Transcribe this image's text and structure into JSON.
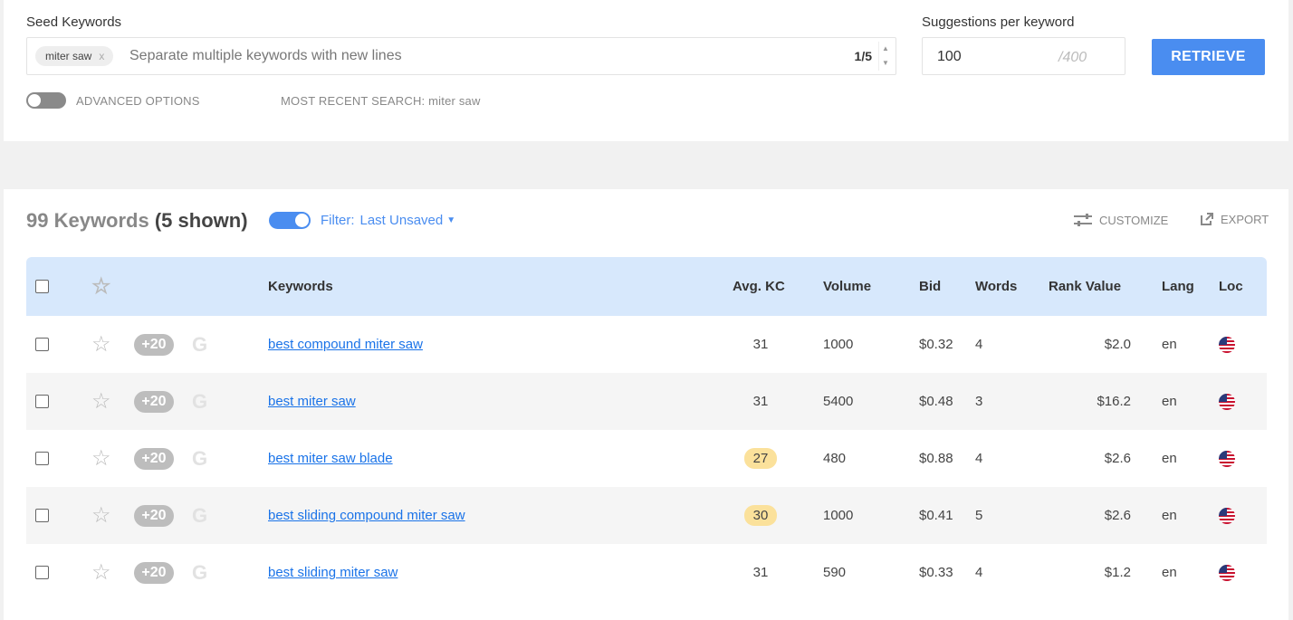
{
  "search": {
    "seed_label": "Seed Keywords",
    "seed_chip": "miter saw",
    "seed_chip_remove": "x",
    "seed_placeholder": "Separate multiple keywords with new lines",
    "seed_counter": "1/5",
    "suggestions_label": "Suggestions per keyword",
    "suggestions_value": "100",
    "suggestions_max": "/400",
    "retrieve_label": "RETRIEVE",
    "advanced_label": "ADVANCED OPTIONS",
    "advanced_enabled": false,
    "recent_label": "MOST RECENT SEARCH: miter saw"
  },
  "results": {
    "count_label": "99 Keywords",
    "shown_label": "(5 shown)",
    "filter_enabled": true,
    "filter_label": "Filter:",
    "filter_value": "Last Unsaved",
    "customize_label": "CUSTOMIZE",
    "export_label": "EXPORT"
  },
  "table": {
    "headers": {
      "keywords": "Keywords",
      "avg_kc": "Avg. KC",
      "volume": "Volume",
      "bid": "Bid",
      "words": "Words",
      "rank_value": "Rank Value",
      "lang": "Lang",
      "loc": "Loc"
    },
    "rows": [
      {
        "plus": "+20",
        "keyword": "best compound miter saw",
        "kc": "31",
        "kc_highlight": false,
        "volume": "1000",
        "bid": "$0.32",
        "words": "4",
        "rank_value": "$2.0",
        "lang": "en",
        "loc": "us-flag-icon"
      },
      {
        "plus": "+20",
        "keyword": "best miter saw",
        "kc": "31",
        "kc_highlight": false,
        "volume": "5400",
        "bid": "$0.48",
        "words": "3",
        "rank_value": "$16.2",
        "lang": "en",
        "loc": "us-flag-icon"
      },
      {
        "plus": "+20",
        "keyword": "best miter saw blade",
        "kc": "27",
        "kc_highlight": true,
        "volume": "480",
        "bid": "$0.88",
        "words": "4",
        "rank_value": "$2.6",
        "lang": "en",
        "loc": "us-flag-icon"
      },
      {
        "plus": "+20",
        "keyword": "best sliding compound miter saw",
        "kc": "30",
        "kc_highlight": true,
        "volume": "1000",
        "bid": "$0.41",
        "words": "5",
        "rank_value": "$2.6",
        "lang": "en",
        "loc": "us-flag-icon"
      },
      {
        "plus": "+20",
        "keyword": "best sliding miter saw",
        "kc": "31",
        "kc_highlight": false,
        "volume": "590",
        "bid": "$0.33",
        "words": "4",
        "rank_value": "$1.2",
        "lang": "en",
        "loc": "us-flag-icon"
      }
    ]
  },
  "colors": {
    "accent": "#4a8df0",
    "header_bg": "#d7e8fc",
    "kc_highlight": "#fbe19b",
    "link": "#1a73e8"
  }
}
